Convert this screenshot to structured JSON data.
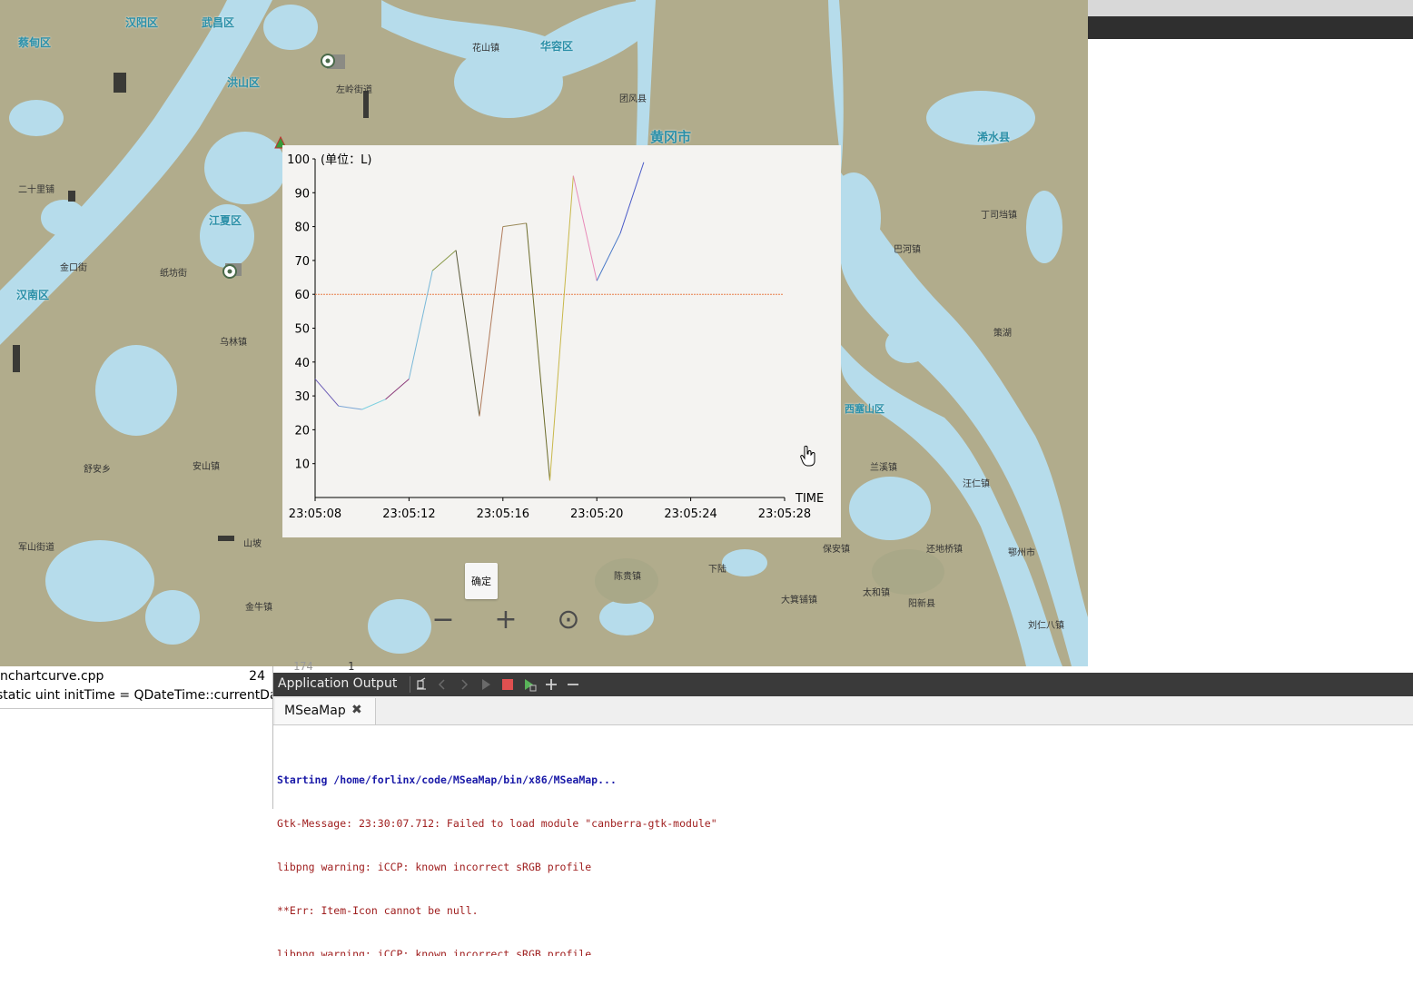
{
  "map": {
    "districts": [
      {
        "id": "hanyang",
        "label": "汉阳区"
      },
      {
        "id": "wuchang",
        "label": "武昌区"
      },
      {
        "id": "caidian",
        "label": "蔡甸区"
      },
      {
        "id": "hongshan",
        "label": "洪山区"
      },
      {
        "id": "huarong",
        "label": "华容区"
      },
      {
        "id": "huanggang",
        "label": "黄冈市"
      },
      {
        "id": "xishui",
        "label": "浠水县"
      },
      {
        "id": "jiangxia",
        "label": "江夏区"
      },
      {
        "id": "hannan",
        "label": "汉南区"
      },
      {
        "id": "xisaishan",
        "label": "西塞山区"
      }
    ],
    "places": [
      {
        "id": "p1",
        "label": "二十里铺"
      },
      {
        "id": "p2",
        "label": "纸坊街"
      },
      {
        "id": "p3",
        "label": "金口街"
      },
      {
        "id": "p4",
        "label": "乌林镇"
      },
      {
        "id": "p5",
        "label": "安山镇"
      },
      {
        "id": "p6",
        "label": "山坡"
      },
      {
        "id": "p7",
        "label": "舒安乡"
      },
      {
        "id": "p8",
        "label": "金牛镇"
      },
      {
        "id": "p9",
        "label": "保安镇"
      },
      {
        "id": "p10",
        "label": "太和镇"
      },
      {
        "id": "p11",
        "label": "大箕铺镇"
      },
      {
        "id": "p12",
        "label": "兰溪镇"
      },
      {
        "id": "p13",
        "label": "团风县"
      },
      {
        "id": "p14",
        "label": "策湖"
      },
      {
        "id": "p15",
        "label": "下陆"
      },
      {
        "id": "p16",
        "label": "巴河镇"
      },
      {
        "id": "p17",
        "label": "丁司垱镇"
      },
      {
        "id": "p18",
        "label": "汪仁镇"
      },
      {
        "id": "p19",
        "label": "还地桥镇"
      },
      {
        "id": "p20",
        "label": "陈贵镇"
      },
      {
        "id": "p21",
        "label": "刘仁八镇"
      },
      {
        "id": "p22",
        "label": "阳新县"
      },
      {
        "id": "p23",
        "label": "军山街道"
      },
      {
        "id": "p24",
        "label": "左岭街道"
      },
      {
        "id": "p25",
        "label": "花山镇"
      },
      {
        "id": "p26",
        "label": "鄂州市"
      }
    ]
  },
  "chart_data": {
    "type": "line",
    "title": "",
    "xlabel": "TIME",
    "ylabel": "(单位：L)",
    "x_tick_labels": [
      "23:05:08",
      "23:05:12",
      "23:05:16",
      "23:05:20",
      "23:05:24",
      "23:05:28"
    ],
    "y_tick_labels": [
      "10",
      "20",
      "30",
      "40",
      "50",
      "60",
      "70",
      "80",
      "90",
      "100"
    ],
    "xlim": [
      "23:05:08",
      "23:05:28"
    ],
    "ylim": [
      0,
      100
    ],
    "grid": false,
    "legend": "none",
    "series": [
      {
        "x": [
          "23:05:08",
          "23:05:09",
          "23:05:10",
          "23:05:11",
          "23:05:12",
          "23:05:13",
          "23:05:14",
          "23:05:15",
          "23:05:16",
          "23:05:17",
          "23:05:18",
          "23:05:19",
          "23:05:20",
          "23:05:21",
          "23:05:22"
        ],
        "values": [
          35,
          27,
          26,
          29,
          35,
          67,
          73,
          24,
          80,
          81,
          5,
          95,
          64,
          78,
          99
        ],
        "segment_colors": [
          "#6b5bb5",
          "#7aa6d6",
          "#7ad0e0",
          "#8b3a7a",
          "#79b8d8",
          "#8a9a4a",
          "#5a5a3a",
          "#b07a5a",
          "#9b8a5a",
          "#6b6b2a",
          "#c8b84a",
          "#e88ab8",
          "#4a7ac8",
          "#4a5ac8"
        ]
      }
    ],
    "reference_line": {
      "value": 60,
      "color": "#e8804a"
    }
  },
  "dialog": {
    "ok_label": "确定"
  },
  "map_controls": {
    "zoom_out": "−",
    "zoom_in": "+",
    "locate": "⊙"
  },
  "editor": {
    "file": "nchartcurve.cpp",
    "line_number": "24",
    "code_line": "static uint initTime = QDateTime::currentDat",
    "ghost_line_a": "174",
    "ghost_line_b": "1"
  },
  "output": {
    "title": "Application Output",
    "tab": "MSeaMap",
    "log": [
      {
        "kind": "start",
        "text": "Starting /home/forlinx/code/MSeaMap/bin/x86/MSeaMap..."
      },
      {
        "kind": "err",
        "text": "Gtk-Message: 23:30:07.712: Failed to load module \"canberra-gtk-module\""
      },
      {
        "kind": "err",
        "text": "libpng warning: iCCP: known incorrect sRGB profile"
      },
      {
        "kind": "err",
        "text": "**Err: Item-Icon cannot be null."
      },
      {
        "kind": "err",
        "text": "libpng warning: iCCP: known incorrect sRGB profile"
      }
    ]
  },
  "colors": {
    "land": "#b1ac8c",
    "water": "#b6dceb",
    "dialog_bg": "#f4f3f1",
    "output_header": "#3a3a3a"
  }
}
